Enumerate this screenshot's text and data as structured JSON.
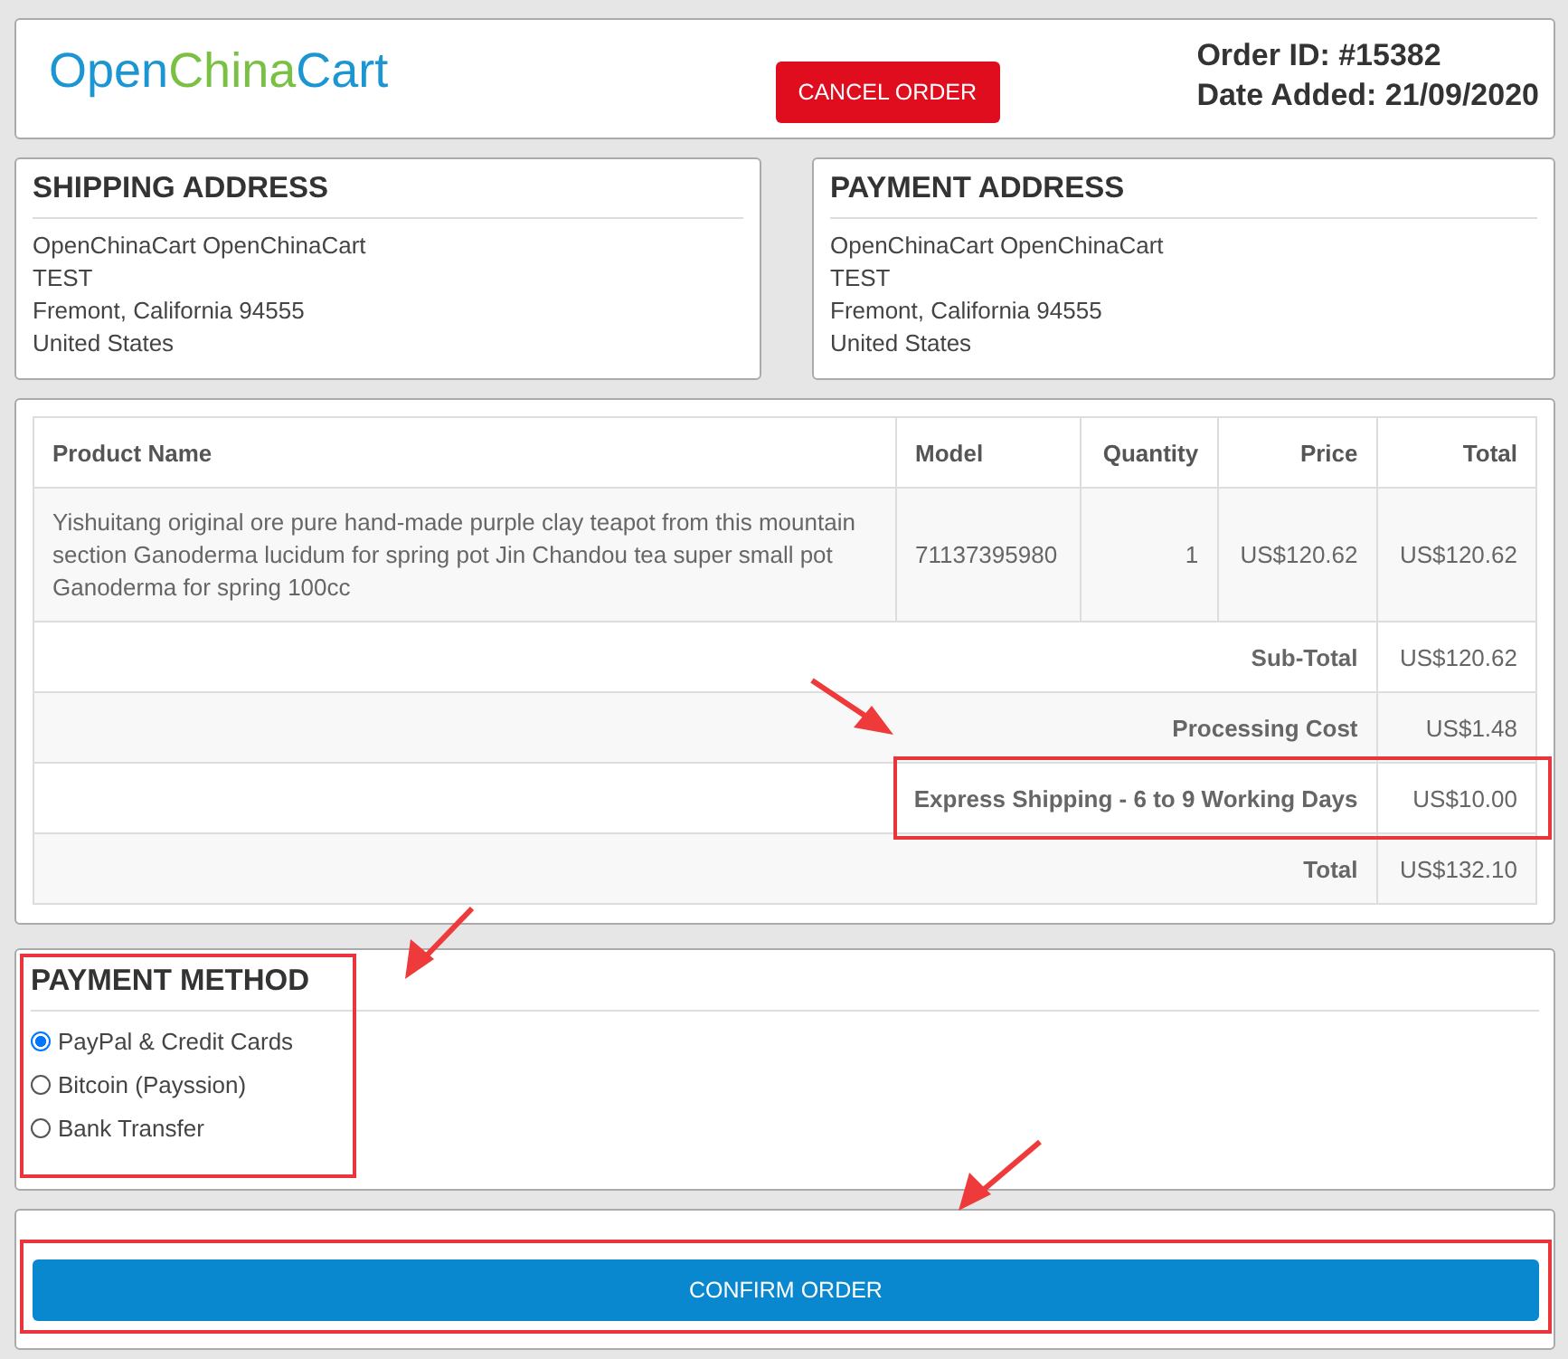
{
  "header": {
    "logo": [
      {
        "text": "Open",
        "color": "#1b96d3"
      },
      {
        "text": "China",
        "color": "#7ac143"
      },
      {
        "text": "Cart",
        "color": "#1b96d3"
      }
    ],
    "cancel_button": "CANCEL ORDER",
    "order_id": "Order ID: #15382",
    "date_added": "Date Added: 21/09/2020"
  },
  "addresses": [
    {
      "title": "SHIPPING ADDRESS",
      "lines": [
        "OpenChinaCart OpenChinaCart",
        "TEST",
        "Fremont, California 94555",
        "United States"
      ]
    },
    {
      "title": "PAYMENT ADDRESS",
      "lines": [
        "OpenChinaCart OpenChinaCart",
        "TEST",
        "Fremont, California 94555",
        "United States"
      ]
    }
  ],
  "table": {
    "columns": [
      "Product Name",
      "Model",
      "Quantity",
      "Price",
      "Total"
    ],
    "rows": [
      {
        "product": "Yishuitang original ore pure hand-made purple clay teapot from this mountain section Ganoderma lucidum for spring pot Jin Chandou tea super small pot Ganoderma for spring 100cc",
        "model": "71137395980",
        "quantity": "1",
        "price": "US$120.62",
        "total": "US$120.62"
      }
    ],
    "totals": [
      {
        "label": "Sub-Total",
        "value": "US$120.62"
      },
      {
        "label": "Processing Cost",
        "value": "US$1.48"
      },
      {
        "label": "Express Shipping - 6 to 9 Working Days",
        "value": "US$10.00"
      },
      {
        "label": "Total",
        "value": "US$132.10"
      }
    ]
  },
  "payment_method": {
    "title": "PAYMENT METHOD",
    "options": [
      {
        "label": "PayPal & Credit Cards",
        "selected": true
      },
      {
        "label": "Bitcoin (Payssion)",
        "selected": false
      },
      {
        "label": "Bank Transfer",
        "selected": false
      }
    ]
  },
  "confirm_button": "CONFIRM ORDER"
}
